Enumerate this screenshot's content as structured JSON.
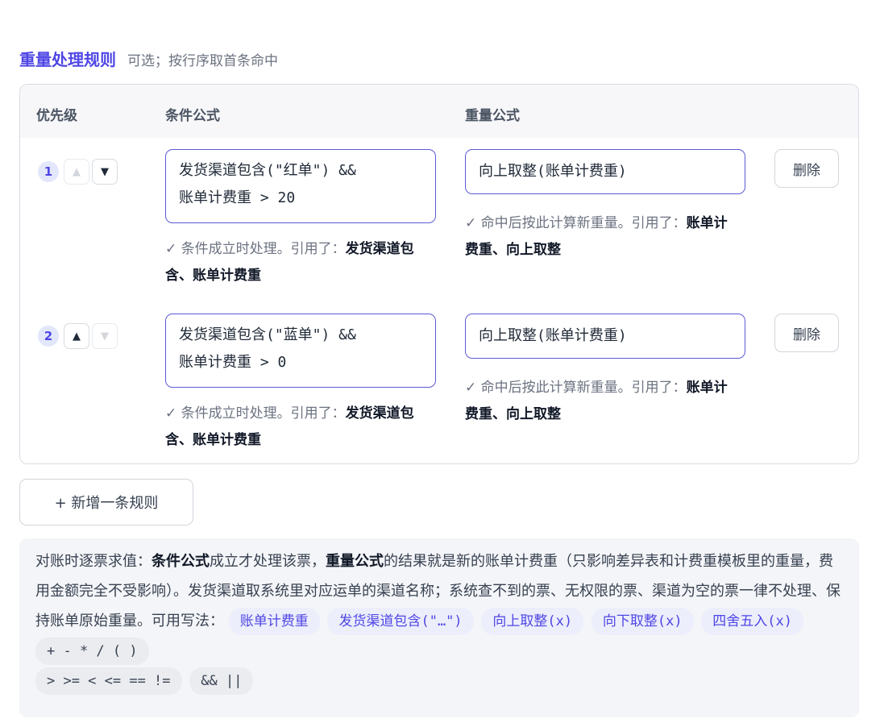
{
  "header": {
    "title": "重量处理规则",
    "subtitle": "可选；按行序取首条命中"
  },
  "table": {
    "columns": {
      "priority": "优先级",
      "condition": "条件公式",
      "weight": "重量公式"
    },
    "rows": [
      {
        "priority": "1",
        "up_arrow": "▲",
        "down_arrow": "▼",
        "condition_line1": "发货渠道包含(\"红单\") &&",
        "condition_line2": "账单计费重 > 20",
        "weight_formula": "向上取整(账单计费重)",
        "condition_hint_prefix": "✓ 条件成立时处理。引用了：",
        "condition_hint_refs": "发货渠道包含、账单计费重",
        "weight_hint_prefix": "✓ 命中后按此计算新重量。引用了：",
        "weight_hint_refs": "账单计费重、向上取整",
        "delete_label": "删除"
      },
      {
        "priority": "2",
        "up_arrow": "▲",
        "down_arrow": "▼",
        "condition_line1": "发货渠道包含(\"蓝单\") &&",
        "condition_line2": "账单计费重 > 0",
        "weight_formula": "向上取整(账单计费重)",
        "condition_hint_prefix": "✓ 条件成立时处理。引用了：",
        "condition_hint_refs": "发货渠道包含、账单计费重",
        "weight_hint_prefix": "✓ 命中后按此计算新重量。引用了：",
        "weight_hint_refs": "账单计费重、向上取整",
        "delete_label": "删除"
      }
    ]
  },
  "add_rule_label": "+ 新增一条规则",
  "note": {
    "p1": "对账时逐票求值：",
    "b1": "条件公式",
    "p2": "成立才处理该票，",
    "b2": "重量公式",
    "p3": "的结果就是新的账单计费重（只影响差异表和计费重模板里的重量，费用金额完全不受影响）。发货渠道取系统里对应运单的渠道名称；系统查不到的票、无权限的票、渠道为空的票一律不处理、保持账单原始重量。可用写法：",
    "chips": [
      "账单计费重",
      "发货渠道包含(\"…\")",
      "向上取整(x)",
      "向下取整(x)",
      "四舍五入(x)"
    ],
    "operator_chips": [
      "+ - * / ( )",
      "> >= < <= == !=",
      "&& ||"
    ]
  },
  "colors": {
    "accent": "#4f46e5",
    "border": "#d9dde3",
    "chip_bg": "#eceefb"
  }
}
